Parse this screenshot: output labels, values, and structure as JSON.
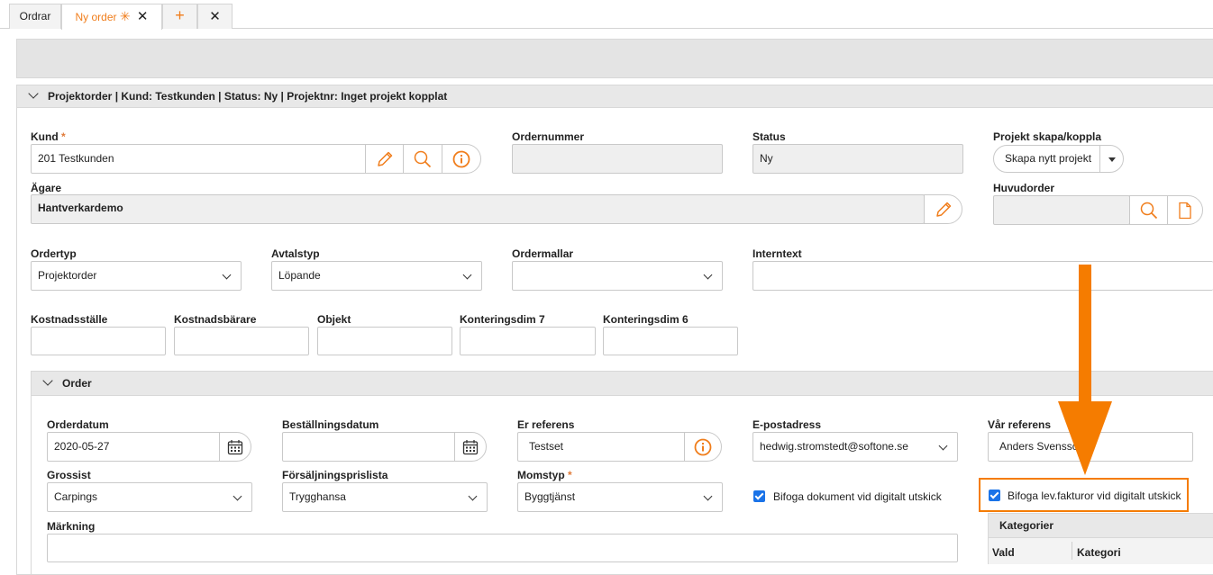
{
  "tabs": [
    {
      "label": "Ordrar"
    },
    {
      "label": "Ny order",
      "modified": "✳",
      "close": "✕"
    }
  ],
  "tab_actions": {
    "add": "+",
    "close": "✕"
  },
  "header_section": {
    "title": "Projektorder | Kund: Testkunden | Status: Ny | Projektnr: Inget projekt kopplat"
  },
  "kund": {
    "label": "Kund",
    "required": "*",
    "value": "201 Testkunden"
  },
  "ordernummer": {
    "label": "Ordernummer",
    "value": ""
  },
  "status": {
    "label": "Status",
    "value": "Ny"
  },
  "projekt": {
    "label": "Projekt skapa/koppla",
    "button": "Skapa nytt projekt"
  },
  "agare": {
    "label": "Ägare",
    "value": "Hantverkardemo"
  },
  "huvudorder": {
    "label": "Huvudorder",
    "value": ""
  },
  "ordertyp": {
    "label": "Ordertyp",
    "value": "Projektorder"
  },
  "avtalstyp": {
    "label": "Avtalstyp",
    "value": "Löpande"
  },
  "ordermallar": {
    "label": "Ordermallar",
    "value": ""
  },
  "internetext": {
    "label": "Interntext",
    "value": ""
  },
  "dims": [
    {
      "label": "Kostnadsställe"
    },
    {
      "label": "Kostnadsbärare"
    },
    {
      "label": "Objekt"
    },
    {
      "label": "Konteringsdim 7"
    },
    {
      "label": "Konteringsdim 6"
    }
  ],
  "order_section": {
    "title": "Order"
  },
  "orderdatum": {
    "label": "Orderdatum",
    "value": "2020-05-27"
  },
  "bestallningsdatum": {
    "label": "Beställningsdatum",
    "value": ""
  },
  "er_referens": {
    "label": "Er referens",
    "value": "Testset"
  },
  "epost": {
    "label": "E-postadress",
    "value": "hedwig.stromstedt@softone.se"
  },
  "var_referens": {
    "label": "Vår referens",
    "value": "Anders Svensson"
  },
  "grossist": {
    "label": "Grossist",
    "value": "Carpings"
  },
  "prislista": {
    "label": "Försäljningsprislista",
    "value": "Trygghansa"
  },
  "momstyp": {
    "label": "Momstyp",
    "required": "*",
    "value": "Byggtjänst"
  },
  "bifoga_dok": {
    "label": "Bifoga dokument vid digitalt utskick",
    "checked": true
  },
  "bifoga_lev": {
    "label": "Bifoga lev.fakturor vid digitalt utskick",
    "checked": true
  },
  "markning": {
    "label": "Märkning",
    "value": ""
  },
  "kategorier": {
    "title": "Kategorier",
    "columns": [
      "Vald",
      "Kategori"
    ]
  },
  "colors": {
    "accent": "#f07d1b",
    "arrow": "#f57c00",
    "checkbox": "#1a73e8"
  },
  "icons": [
    "pencil-icon",
    "search-icon",
    "info-icon",
    "calendar-icon",
    "document-icon",
    "caret-down-icon",
    "chevron-down-icon",
    "arrow-down-icon"
  ]
}
